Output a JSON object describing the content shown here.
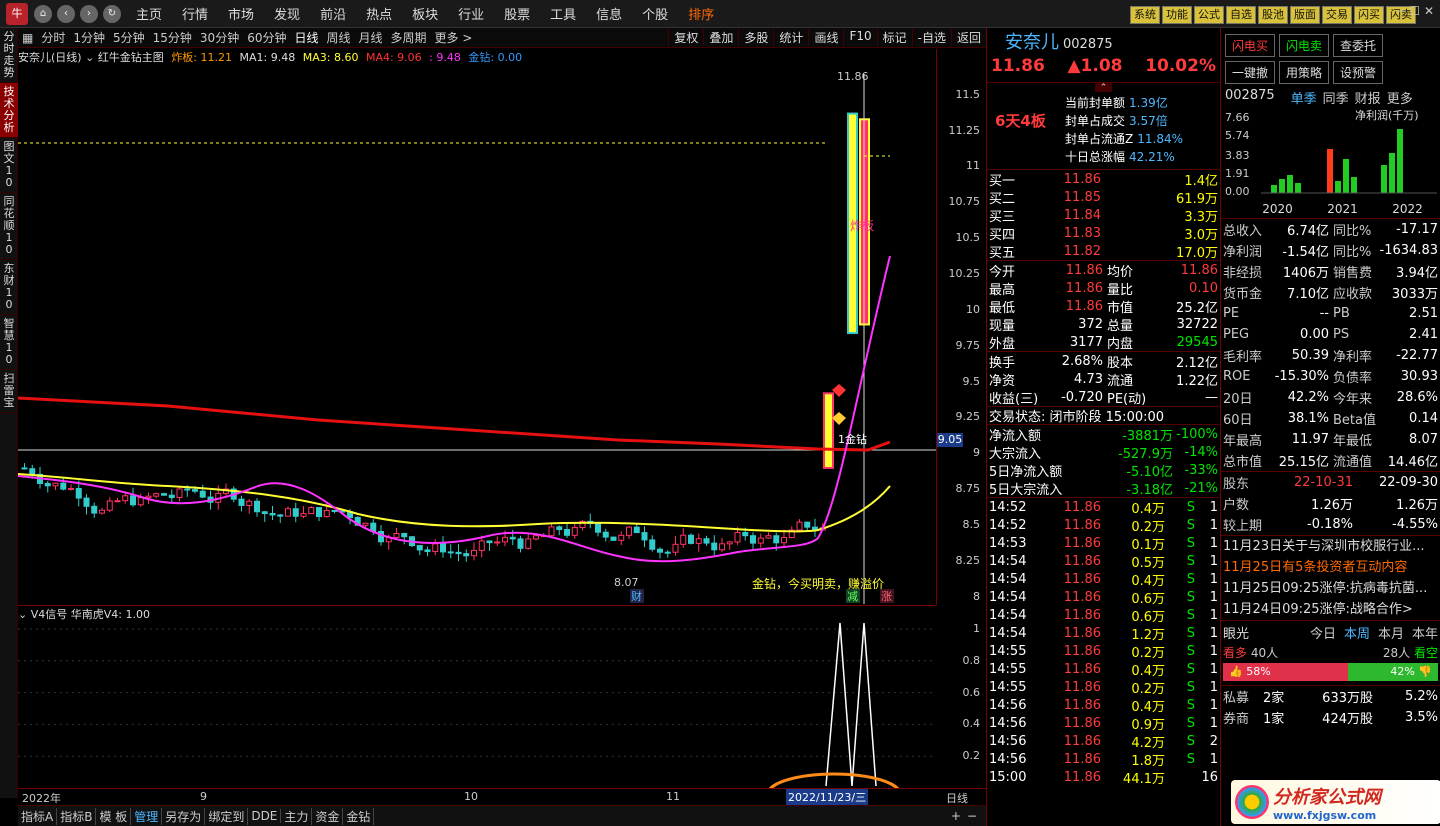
{
  "menubar": {
    "items": [
      "主页",
      "行情",
      "市场",
      "发现",
      "前沿",
      "热点",
      "板块",
      "行业",
      "股票",
      "工具",
      "信息",
      "个股",
      "排序"
    ],
    "right_buttons": [
      "系统",
      "功能",
      "公式",
      "自选",
      "股池",
      "版面",
      "交易",
      "闪买",
      "闪卖"
    ]
  },
  "vtabs": [
    "分时走势",
    "技术分析",
    "图文10",
    "同花顺10",
    "东财10",
    "智慧10",
    "扫雷宝"
  ],
  "periods": [
    "分时",
    "1分钟",
    "5分钟",
    "15分钟",
    "30分钟",
    "60分钟",
    "日线",
    "周线",
    "月线",
    "多周期",
    "更多 >"
  ],
  "tools": [
    "复权",
    "叠加",
    "多股",
    "统计",
    "画线",
    "F10",
    "标记",
    "-自选",
    "返回"
  ],
  "chart_header": {
    "title": "安奈儿(日线)",
    "indicator": "红牛金钻主图",
    "zha_label": "炸板: 11.21",
    "ma1": "MA1: 9.48",
    "ma3": "MA3: 8.60",
    "ma4": "MA4: 9.06",
    "ma_extra": ": 9.48",
    "jinzuan": "金钻: 0.00"
  },
  "annotations": {
    "high_label": "11.86",
    "zha_tag": "炸板",
    "low_label": "8.07",
    "jinzuan_text": "1金钻",
    "buy_text": "金钻，今买明卖，赚溢价",
    "cai": "财",
    "jian": "减",
    "zhang": "涨",
    "price_line": "9.05"
  },
  "chart_data": [
    {
      "type": "candlestick",
      "title": "安奈儿(日线)",
      "ylim": [
        7.95,
        11.7
      ],
      "yticks": [
        8.0,
        8.25,
        8.5,
        8.75,
        9.0,
        9.25,
        9.5,
        9.75,
        10.0,
        10.25,
        10.5,
        10.75,
        11.0,
        11.25,
        11.5
      ],
      "x_labels": [
        "2022年",
        "9",
        "10",
        "11"
      ],
      "series": [
        {
          "name": "MA1",
          "value_last": 9.48
        },
        {
          "name": "MA3",
          "value_last": 8.6
        },
        {
          "name": "MA4",
          "value_last": 9.06
        }
      ],
      "markers": {
        "high": 11.86,
        "low": 8.07,
        "zha_ban": 11.21
      }
    },
    {
      "type": "line",
      "title": "V4信号 华南虎V4: 1.00",
      "ylim": [
        0,
        1.05
      ],
      "yticks": [
        0.2,
        0.4,
        0.6,
        0.8,
        1.0
      ]
    }
  ],
  "sub_header": "V4信号  华南虎V4: 1.00",
  "xaxis": {
    "labels": [
      "2022年",
      "9",
      "10",
      "11"
    ],
    "cursor_date": "2022/11/23/三",
    "period": "日线"
  },
  "bottom_tabs": [
    "指标A",
    "指标B",
    "模 板",
    "管理",
    "另存为",
    "绑定到",
    "DDE",
    "主力",
    "资金",
    "金钻"
  ],
  "stock": {
    "name": "安奈儿",
    "code": "002875",
    "price": "11.86",
    "change": "▲1.08",
    "pct": "10.02%",
    "board": "6天4板",
    "seal": [
      {
        "k": "当前封单额",
        "v": "1.39亿"
      },
      {
        "k": "封单占成交",
        "v": "3.57倍"
      },
      {
        "k": "封单占流通Z",
        "v": "11.84%"
      },
      {
        "k": "十日总涨幅",
        "v": "42.21%"
      }
    ],
    "bids": [
      {
        "k": "买一",
        "p": "11.86",
        "v": "1.4亿"
      },
      {
        "k": "买二",
        "p": "11.85",
        "v": "61.9万"
      },
      {
        "k": "买三",
        "p": "11.84",
        "v": "3.3万"
      },
      {
        "k": "买四",
        "p": "11.83",
        "v": "3.0万"
      },
      {
        "k": "买五",
        "p": "11.82",
        "v": "17.0万"
      }
    ],
    "stats": [
      {
        "a": "今开",
        "av": "11.86",
        "b": "均价",
        "bv": "11.86"
      },
      {
        "a": "最高",
        "av": "11.86",
        "b": "量比",
        "bv": "0.10"
      },
      {
        "a": "最低",
        "av": "11.86",
        "b": "市值",
        "bv": "25.2亿"
      },
      {
        "a": "现量",
        "av": "372",
        "b": "总量",
        "bv": "32722"
      },
      {
        "a": "外盘",
        "av": "3177",
        "b": "内盘",
        "bv": "29545"
      }
    ],
    "stats2": [
      {
        "a": "换手",
        "av": "2.68%",
        "b": "股本",
        "bv": "2.12亿"
      },
      {
        "a": "净资",
        "av": "4.73",
        "b": "流通",
        "bv": "1.22亿"
      },
      {
        "a": "收益(三)",
        "av": "-0.720",
        "b": "PE(动)",
        "bv": "—"
      }
    ],
    "trade_status": "交易状态: 闭市阶段 15:00:00",
    "flows": [
      {
        "k": "净流入额",
        "v": "-3881万",
        "p": "-100%"
      },
      {
        "k": "大宗流入",
        "v": "-527.9万",
        "p": "-14%"
      },
      {
        "k": "5日净流入额",
        "v": "-5.10亿",
        "p": "-33%"
      },
      {
        "k": "5日大宗流入",
        "v": "-3.18亿",
        "p": "-21%"
      }
    ],
    "ticks": [
      {
        "t": "14:52",
        "p": "11.86",
        "v": "0.4万",
        "s": "S",
        "n": "1"
      },
      {
        "t": "14:52",
        "p": "11.86",
        "v": "0.2万",
        "s": "S",
        "n": "1"
      },
      {
        "t": "14:53",
        "p": "11.86",
        "v": "0.1万",
        "s": "S",
        "n": "1"
      },
      {
        "t": "14:54",
        "p": "11.86",
        "v": "0.5万",
        "s": "S",
        "n": "1"
      },
      {
        "t": "14:54",
        "p": "11.86",
        "v": "0.4万",
        "s": "S",
        "n": "1"
      },
      {
        "t": "14:54",
        "p": "11.86",
        "v": "0.6万",
        "s": "S",
        "n": "1"
      },
      {
        "t": "14:54",
        "p": "11.86",
        "v": "0.6万",
        "s": "S",
        "n": "1"
      },
      {
        "t": "14:54",
        "p": "11.86",
        "v": "1.2万",
        "s": "S",
        "n": "1"
      },
      {
        "t": "14:55",
        "p": "11.86",
        "v": "0.2万",
        "s": "S",
        "n": "1"
      },
      {
        "t": "14:55",
        "p": "11.86",
        "v": "0.4万",
        "s": "S",
        "n": "1"
      },
      {
        "t": "14:55",
        "p": "11.86",
        "v": "0.2万",
        "s": "S",
        "n": "1"
      },
      {
        "t": "14:56",
        "p": "11.86",
        "v": "0.4万",
        "s": "S",
        "n": "1"
      },
      {
        "t": "14:56",
        "p": "11.86",
        "v": "0.9万",
        "s": "S",
        "n": "1"
      },
      {
        "t": "14:56",
        "p": "11.86",
        "v": "4.2万",
        "s": "S",
        "n": "2"
      },
      {
        "t": "14:56",
        "p": "11.86",
        "v": "1.8万",
        "s": "S",
        "n": "1"
      },
      {
        "t": "15:00",
        "p": "11.86",
        "v": "44.1万",
        "s": "",
        "n": "16"
      }
    ]
  },
  "fin": {
    "buttons": [
      "闪电买",
      "闪电卖",
      "查委托",
      "一键撤",
      "用策略",
      "设预警"
    ],
    "code": "002875",
    "tabs": [
      "单季",
      "同季",
      "财报",
      "更多"
    ],
    "chart_title": "净利润(千万)",
    "chart_yticks": [
      "7.66",
      "5.74",
      "3.83",
      "1.91",
      "0.00"
    ],
    "chart_years": [
      "2020",
      "2021",
      "2022"
    ],
    "rows": [
      {
        "a": "总收入",
        "av": "6.74亿",
        "b": "同比%",
        "bv": "-17.17"
      },
      {
        "a": "净利润",
        "av": "-1.54亿",
        "b": "同比%",
        "bv": "-1634.83"
      },
      {
        "a": "非经损",
        "av": "1406万",
        "b": "销售费",
        "bv": "3.94亿"
      },
      {
        "a": "货币金",
        "av": "7.10亿",
        "b": "应收款",
        "bv": "3033万"
      },
      {
        "a": "PE",
        "av": "--",
        "b": "PB",
        "bv": "2.51"
      },
      {
        "a": "PEG",
        "av": "0.00",
        "b": "PS",
        "bv": "2.41"
      },
      {
        "a": "毛利率",
        "av": "50.39",
        "b": "净利率",
        "bv": "-22.77"
      },
      {
        "a": "ROE",
        "av": "-15.30%",
        "b": "负债率",
        "bv": "30.93"
      },
      {
        "a": "20日",
        "av": "42.2%",
        "b": "今年来",
        "bv": "28.6%"
      },
      {
        "a": "60日",
        "av": "38.1%",
        "b": "Beta值",
        "bv": "0.14"
      },
      {
        "a": "年最高",
        "av": "11.97",
        "b": "年最低",
        "bv": "8.07"
      },
      {
        "a": "总市值",
        "av": "25.15亿",
        "b": "流通值",
        "bv": "14.46亿"
      }
    ],
    "holders": [
      {
        "a": "股东",
        "av": "22-10-31",
        "bv": "22-09-30"
      },
      {
        "a": "户数",
        "av": "1.26万",
        "bv": "1.26万"
      },
      {
        "a": "较上期",
        "av": "-0.18%",
        "bv": "-4.55%"
      }
    ],
    "news": [
      "11月23日关于与深圳市校服行业...",
      "11月25日有5条投资者互动内容",
      "11月25日09:25涨停:抗病毒抗菌...",
      "11月24日09:25涨停:战略合作>"
    ],
    "eye": {
      "label": "眼光",
      "tabs": [
        "今日",
        "本周",
        "本月",
        "本年"
      ],
      "bull": "看多",
      "bull_n": "40人",
      "bear_n": "28人",
      "bear": "看空",
      "bull_pct": "58%",
      "bear_pct": "42%"
    },
    "inst": [
      {
        "a": "私募",
        "b": "2家",
        "c": "633万股",
        "d": "5.2%"
      },
      {
        "a": "券商",
        "b": "1家",
        "c": "424万股",
        "d": "3.5%"
      }
    ],
    "watermark": "分析家公式网",
    "watermark_url": "www.fxjgsw.com"
  }
}
